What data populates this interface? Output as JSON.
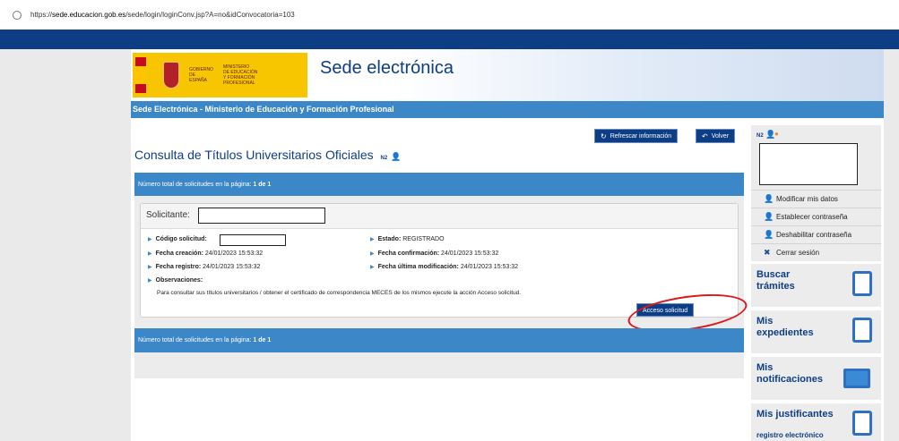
{
  "browser": {
    "url_prefix": "https://",
    "url_domain": "sede.educacion.gob.es",
    "url_path": "/sede/login/loginConv.jsp?A=no&idConvocatoria=103"
  },
  "header": {
    "logo_line1": "GOBIERNO\nDE ESPAÑA",
    "logo_line2": "MINISTERIO\nDE EDUCACIÓN\nY FORMACIÓN PROFESIONAL",
    "site_title": "Sede electrónica",
    "bar_title": "Sede Electrónica - Ministerio de Educación y Formación Profesional"
  },
  "actions": {
    "refresh_label": "Refrescar información",
    "back_label": "Volver"
  },
  "page": {
    "title": "Consulta de Títulos Universitarios Oficiales",
    "level": "N2"
  },
  "count_bar": {
    "prefix": "Número total de solicitudes en la página:",
    "value": "1 de 1"
  },
  "request": {
    "solicitante_label": "Solicitante:",
    "codigo_label": "Código solicitud:",
    "estado_label": "Estado:",
    "estado_value": "REGISTRADO",
    "fecha_creacion_label": "Fecha creación:",
    "fecha_creacion_value": "24/01/2023 15:53:32",
    "fecha_confirmacion_label": "Fecha confirmación:",
    "fecha_confirmacion_value": "24/01/2023 15:53:32",
    "fecha_registro_label": "Fecha registro:",
    "fecha_registro_value": "24/01/2023 15:53:32",
    "fecha_ultima_label": "Fecha última modificación:",
    "fecha_ultima_value": "24/01/2023 15:53:32",
    "observaciones_label": "Observaciones:",
    "observaciones_text": "Para consultar sus títulos universitarios / obtener el certificado de correspondencia MECES de los mismos ejecute la acción Acceso solicitud.",
    "acceso_label": "Acceso solicitud"
  },
  "sidebar": {
    "level": "N2",
    "menu": [
      {
        "label": "Modificar mis datos",
        "icon": "user-edit-icon"
      },
      {
        "label": "Establecer contraseña",
        "icon": "user-key-icon"
      },
      {
        "label": "Deshabilitar contraseña",
        "icon": "user-lock-icon"
      },
      {
        "label": "Cerrar sesión",
        "icon": "close-icon"
      }
    ],
    "tiles": [
      {
        "line1": "Buscar",
        "line2": "trámites",
        "icon": "search-document-icon"
      },
      {
        "line1": "Mis",
        "line2": "expedientes",
        "icon": "folder-search-icon"
      },
      {
        "line1": "Mis",
        "line2": "notificaciones",
        "icon": "envelope-icon"
      },
      {
        "line1": "Mis justificantes",
        "line2": "registro electrónico",
        "icon": "receipt-icon"
      }
    ]
  },
  "colors": {
    "brand_dark": "#0d3d84",
    "brand_light": "#3b87c8",
    "highlight": "#e0161b"
  }
}
